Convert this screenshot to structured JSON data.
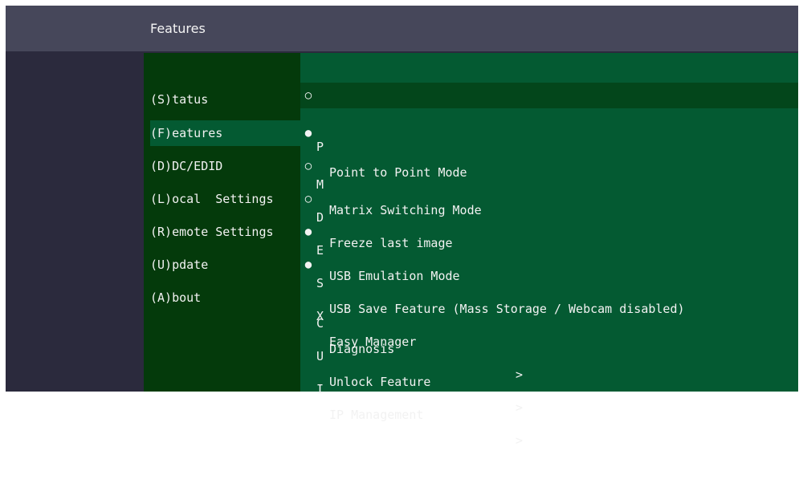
{
  "header": {
    "title": "Features"
  },
  "nav": {
    "items": [
      {
        "label": "(S)tatus",
        "active": false
      },
      {
        "label": "(F)eatures",
        "active": true
      },
      {
        "label": "(D)DC/EDID",
        "active": false
      },
      {
        "label": "(L)ocal  Settings",
        "active": false
      },
      {
        "label": "(R)emote Settings",
        "active": false
      },
      {
        "label": "(U)pdate",
        "active": false
      },
      {
        "label": "(A)bout",
        "active": false
      }
    ]
  },
  "features": {
    "items": [
      {
        "bullet": "○",
        "key": "P",
        "label": "Point to Point Mode",
        "arrow": "",
        "highlighted": true
      },
      {
        "bullet": "●",
        "key": "M",
        "label": "Matrix Switching Mode",
        "arrow": ""
      },
      {
        "bullet": "○",
        "key": "D",
        "label": "Freeze last image",
        "arrow": ""
      },
      {
        "bullet": "○",
        "key": "E",
        "label": "USB Emulation Mode",
        "arrow": ""
      },
      {
        "bullet": "●",
        "key": "S",
        "label": "USB Save Feature (Mass Storage / Webcam disabled)",
        "arrow": ""
      },
      {
        "bullet": "●",
        "key": "X",
        "label": "Easy Manager",
        "arrow": ""
      },
      {
        "bullet": "",
        "key": "C",
        "label": "Diagnosis",
        "arrow": ">"
      },
      {
        "bullet": "",
        "key": "U",
        "label": "Unlock Feature",
        "arrow": ">"
      },
      {
        "bullet": "",
        "key": "I",
        "label": "IP Management",
        "arrow": ">"
      }
    ]
  }
}
